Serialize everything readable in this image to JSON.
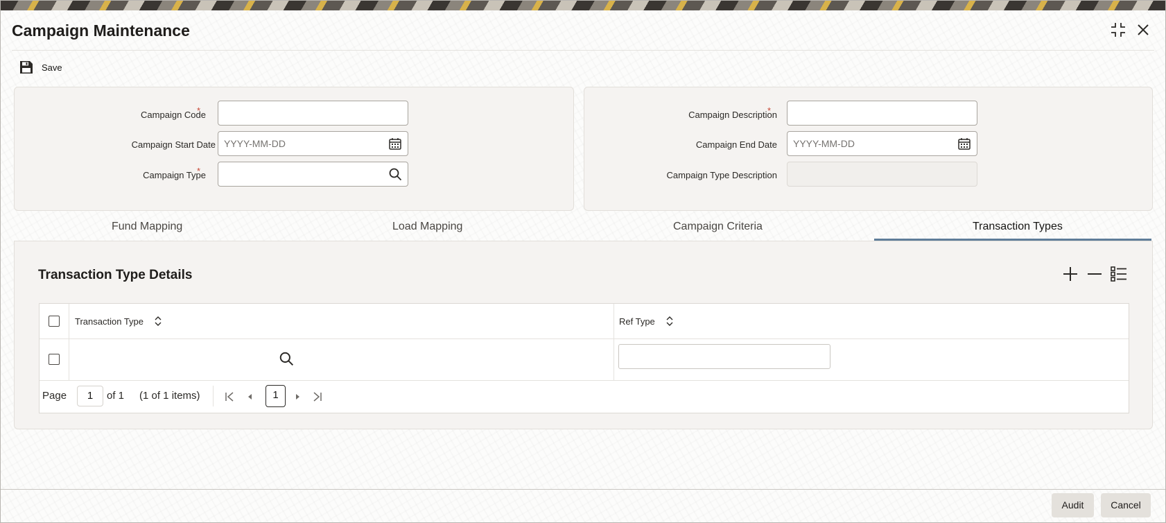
{
  "window": {
    "title": "Campaign Maintenance"
  },
  "toolbar": {
    "save_label": "Save"
  },
  "form": {
    "campaign_code": {
      "label": "Campaign Code",
      "required_mark": "*",
      "value": ""
    },
    "campaign_start_date": {
      "label": "Campaign Start Date",
      "placeholder": "YYYY-MM-DD"
    },
    "campaign_type": {
      "label": "Campaign Type",
      "required_mark": "*",
      "value": ""
    },
    "campaign_description": {
      "label": "Campaign Description",
      "required_mark": "*",
      "value": ""
    },
    "campaign_end_date": {
      "label": "Campaign End Date",
      "placeholder": "YYYY-MM-DD"
    },
    "campaign_type_description": {
      "label": "Campaign Type Description",
      "value": ""
    }
  },
  "tabs": [
    {
      "label": "Fund Mapping",
      "active": false
    },
    {
      "label": "Load Mapping",
      "active": false
    },
    {
      "label": "Campaign Criteria",
      "active": false
    },
    {
      "label": "Transaction Types",
      "active": true
    }
  ],
  "section": {
    "title": "Transaction Type Details",
    "columns": [
      "Transaction Type",
      "Ref Type"
    ],
    "rows": [
      {
        "transaction_type": "",
        "ref_type": ""
      }
    ]
  },
  "pager": {
    "page_label": "Page",
    "page_value": "1",
    "of_label": "of 1",
    "items_label": "(1 of 1 items)",
    "current_page": "1"
  },
  "footer": {
    "audit_label": "Audit",
    "cancel_label": "Cancel"
  },
  "colors": {
    "accent": "#5f7d99",
    "required": "#c74634"
  },
  "icons": [
    "maximize-icon",
    "close-icon",
    "save-icon",
    "calendar-icon",
    "search-icon",
    "add-icon",
    "remove-icon",
    "list-view-icon",
    "sort-icon",
    "first-page-icon",
    "prev-page-icon",
    "next-page-icon",
    "last-page-icon"
  ]
}
